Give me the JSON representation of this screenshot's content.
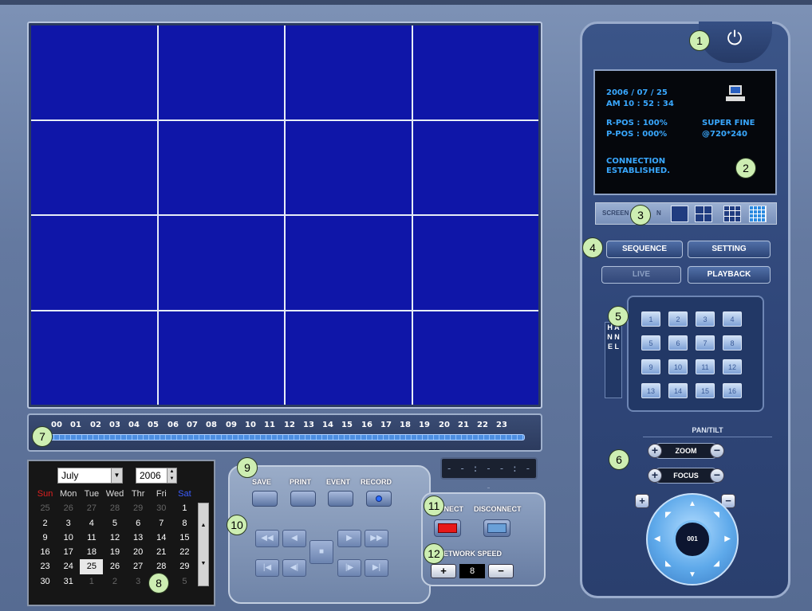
{
  "timeline": {
    "hours": [
      "00",
      "01",
      "02",
      "03",
      "04",
      "05",
      "06",
      "07",
      "08",
      "09",
      "10",
      "11",
      "12",
      "13",
      "14",
      "15",
      "16",
      "17",
      "18",
      "19",
      "20",
      "21",
      "22",
      "23"
    ],
    "timer_text": "- - : - - : - -"
  },
  "calendar": {
    "month": "July",
    "year": "2006",
    "weekdays": [
      "Sun",
      "Mon",
      "Tue",
      "Wed",
      "Thr",
      "Fri",
      "Sat"
    ],
    "weeks": [
      [
        "25",
        "26",
        "27",
        "28",
        "29",
        "30",
        "1"
      ],
      [
        "2",
        "3",
        "4",
        "5",
        "6",
        "7",
        "8"
      ],
      [
        "9",
        "10",
        "11",
        "12",
        "13",
        "14",
        "15"
      ],
      [
        "16",
        "17",
        "18",
        "19",
        "20",
        "21",
        "22"
      ],
      [
        "23",
        "24",
        "25",
        "26",
        "27",
        "28",
        "29"
      ],
      [
        "30",
        "31",
        "1",
        "2",
        "3",
        "4",
        "5"
      ]
    ],
    "selected_day": "25"
  },
  "controls": {
    "save": "SAVE",
    "print": "PRINT",
    "event": "EVENT",
    "record": "RECORD"
  },
  "network": {
    "connect": "NNECT",
    "disconnect": "DISCONNECT",
    "speed_label": "ETWORK SPEED",
    "speed_value": "8",
    "plus": "+",
    "minus": "−"
  },
  "lcd": {
    "date": "2006 / 07 / 25",
    "time": "AM 10 : 52 : 34",
    "rpos": "R-POS : 100%",
    "ppos": "P-POS : 000%",
    "quality": "SUPER FINE",
    "resolution": "@720*240",
    "status_line1": "CONNECTION",
    "status_line2": "ESTABLISHED."
  },
  "screen_split_label": "SCREEN",
  "screen_split_label2": "N",
  "menu": {
    "sequence": "SEQUENCE",
    "setting": "SETTING",
    "live": "LIVE",
    "playback": "PLAYBACK"
  },
  "channel_label": "H A N N E L",
  "channels": [
    "1",
    "2",
    "3",
    "4",
    "5",
    "6",
    "7",
    "8",
    "9",
    "10",
    "11",
    "12",
    "13",
    "14",
    "15",
    "16"
  ],
  "ptz": {
    "title": "PAN/TILT",
    "zoom": "ZOOM",
    "focus": "FOCUS",
    "center": "001"
  },
  "badges": [
    "1",
    "2",
    "3",
    "4",
    "5",
    "6",
    "7",
    "8",
    "9",
    "10",
    "11",
    "12"
  ],
  "colors": {
    "video_cell": "#0f16a8",
    "lcd_text": "#39a8ff",
    "badge": "#cdeeb2"
  }
}
